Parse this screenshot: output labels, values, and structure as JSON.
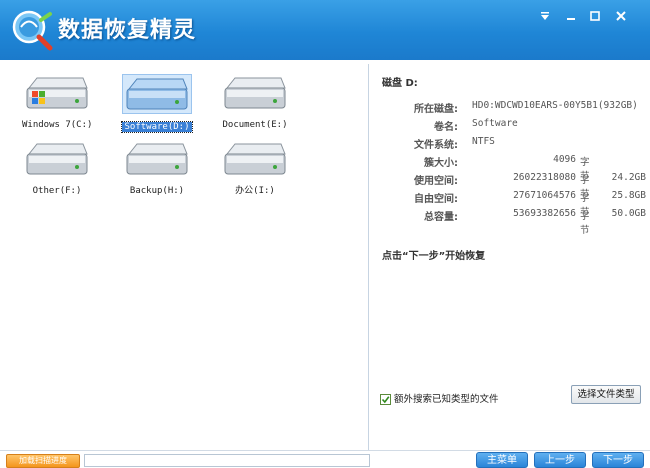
{
  "window": {
    "title": "数据恢复精灵"
  },
  "drives": [
    {
      "label": "Windows 7(C:)",
      "type": "system",
      "selected": false
    },
    {
      "label": "Software(D:)",
      "type": "normal",
      "selected": true
    },
    {
      "label": "Document(E:)",
      "type": "normal",
      "selected": false
    },
    {
      "label": "Other(F:)",
      "type": "normal",
      "selected": false
    },
    {
      "label": "Backup(H:)",
      "type": "normal",
      "selected": false
    },
    {
      "label": "办公(I:)",
      "type": "normal",
      "selected": false
    }
  ],
  "disk_info": {
    "title": "磁盘 D:",
    "disk_label": "所在磁盘:",
    "disk_value": "HD0:WDCWD10EARS-00Y5B1(932GB)",
    "volume_label": "卷名:",
    "volume_value": "Software",
    "fs_label": "文件系统:",
    "fs_value": "NTFS",
    "cluster_label": "簇大小:",
    "cluster_value": "4096",
    "cluster_unit": "字节",
    "used_label": "使用空间:",
    "used_bytes": "26022318080",
    "used_unit": "字节",
    "used_gb": "24.2GB",
    "free_label": "自由空间:",
    "free_bytes": "27671064576",
    "free_unit": "字节",
    "free_gb": "25.8GB",
    "total_label": "总容量:",
    "total_bytes": "53693382656",
    "total_unit": "字节",
    "total_gb": "50.0GB"
  },
  "hint": "点击“下一步”开始恢复",
  "extra_search": {
    "label": "额外搜索已知类型的文件",
    "checked": true
  },
  "buttons": {
    "file_type": "选择文件类型",
    "load_scan": "加载扫描进度",
    "main_menu": "主菜单",
    "prev": "上一步",
    "next": "下一步"
  },
  "colors": {
    "titlebar": "#1f86d6",
    "selection": "#3a80d6",
    "orange": "#f4951c"
  }
}
